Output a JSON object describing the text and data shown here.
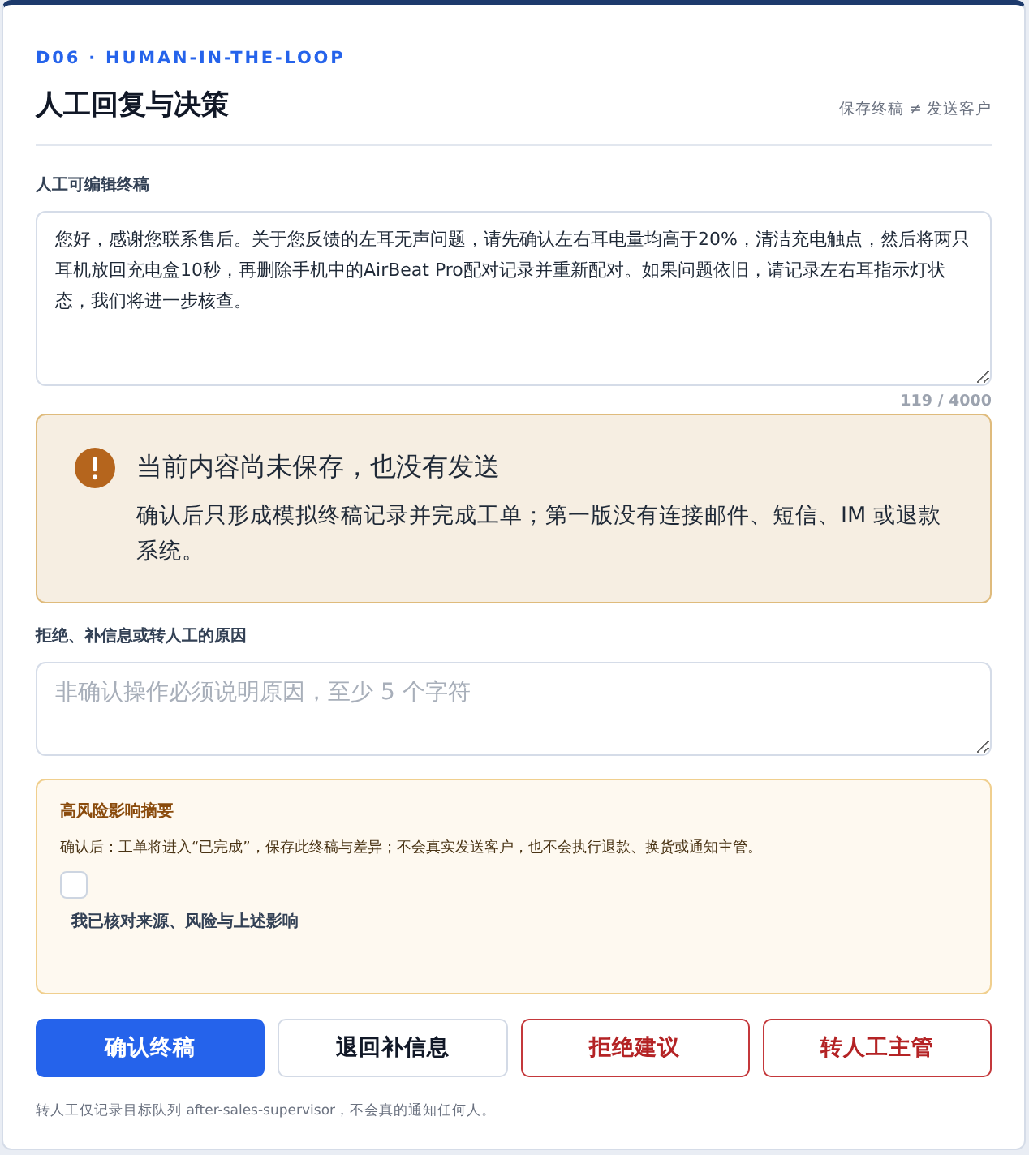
{
  "header": {
    "eyebrow": "D06 · HUMAN-IN-THE-LOOP",
    "title": "人工回复与决策",
    "note": "保存终稿 ≠ 发送客户"
  },
  "draft": {
    "label": "人工可编辑终稿",
    "value": "您好，感谢您联系售后。关于您反馈的左耳无声问题，请先确认左右耳电量均高于20%，清洁充电触点，然后将两只耳机放回充电盒10秒，再删除手机中的AirBeat Pro配对记录并重新配对。如果问题依旧，请记录左右耳指示灯状态，我们将进一步核查。",
    "counter": "119 / 4000"
  },
  "notice": {
    "title": "当前内容尚未保存，也没有发送",
    "body": "确认后只形成模拟终稿记录并完成工单；第一版没有连接邮件、短信、IM 或退款系统。"
  },
  "reason": {
    "label": "拒绝、补信息或转人工的原因",
    "placeholder": "非确认操作必须说明原因，至少 5 个字符"
  },
  "risk": {
    "title": "高风险影响摘要",
    "text": "确认后：工单将进入“已完成”，保存此终稿与差异；不会真实发送客户，也不会执行退款、换货或通知主管。",
    "checkbox": {
      "label": "我已核对来源、风险与上述影响",
      "checked": false
    }
  },
  "buttons": [
    {
      "label": "确认终稿",
      "kind": "primary"
    },
    {
      "label": "退回补信息",
      "kind": "secondary"
    },
    {
      "label": "拒绝建议",
      "kind": "danger"
    },
    {
      "label": "转人工主管",
      "kind": "danger"
    }
  ],
  "footnote": "转人工仅记录目标队列 after-sales-supervisor，不会真的通知任何人。"
}
